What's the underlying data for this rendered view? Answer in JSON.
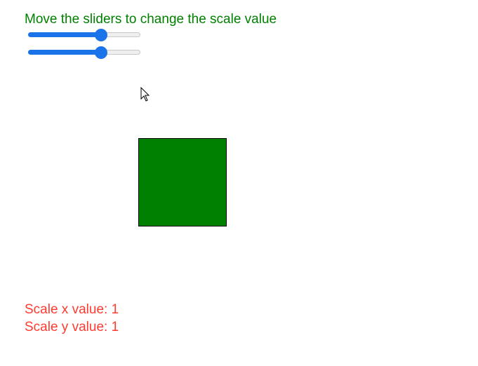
{
  "instruction": "Move the sliders to change the scale value",
  "sliders": {
    "x": {
      "value": 0.65
    },
    "y": {
      "value": 0.65
    }
  },
  "readouts": {
    "x_label": "Scale x value: 1",
    "y_label": "Scale y value: 1"
  },
  "colors": {
    "instruction": "#008000",
    "box": "#008000",
    "readout": "#ff3b30",
    "slider_accent": "#1a73e8"
  },
  "icons": {
    "cursor": "mouse-pointer-icon"
  }
}
